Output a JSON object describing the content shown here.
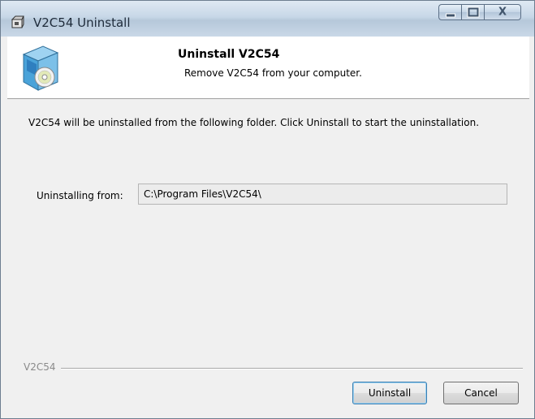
{
  "window": {
    "title": "V2C54 Uninstall",
    "close_glyph": "X"
  },
  "header": {
    "title": "Uninstall V2C54",
    "subtitle": "Remove V2C54 from your computer."
  },
  "body": {
    "intro": "V2C54 will be uninstalled from the following folder. Click Uninstall to start the uninstallation.",
    "field_label": "Uninstalling from:",
    "field_value": "C:\\Program Files\\V2C54\\",
    "brand": "V2C54"
  },
  "buttons": {
    "uninstall": "Uninstall",
    "cancel": "Cancel"
  },
  "icons": {
    "app": "installer-box-icon",
    "header": "installer-cd-box-icon"
  },
  "colors": {
    "titlebar": "#c7d7e7",
    "background": "#f0f0f0",
    "header_bg": "#ffffff",
    "default_button_border": "#3c7fb1"
  }
}
